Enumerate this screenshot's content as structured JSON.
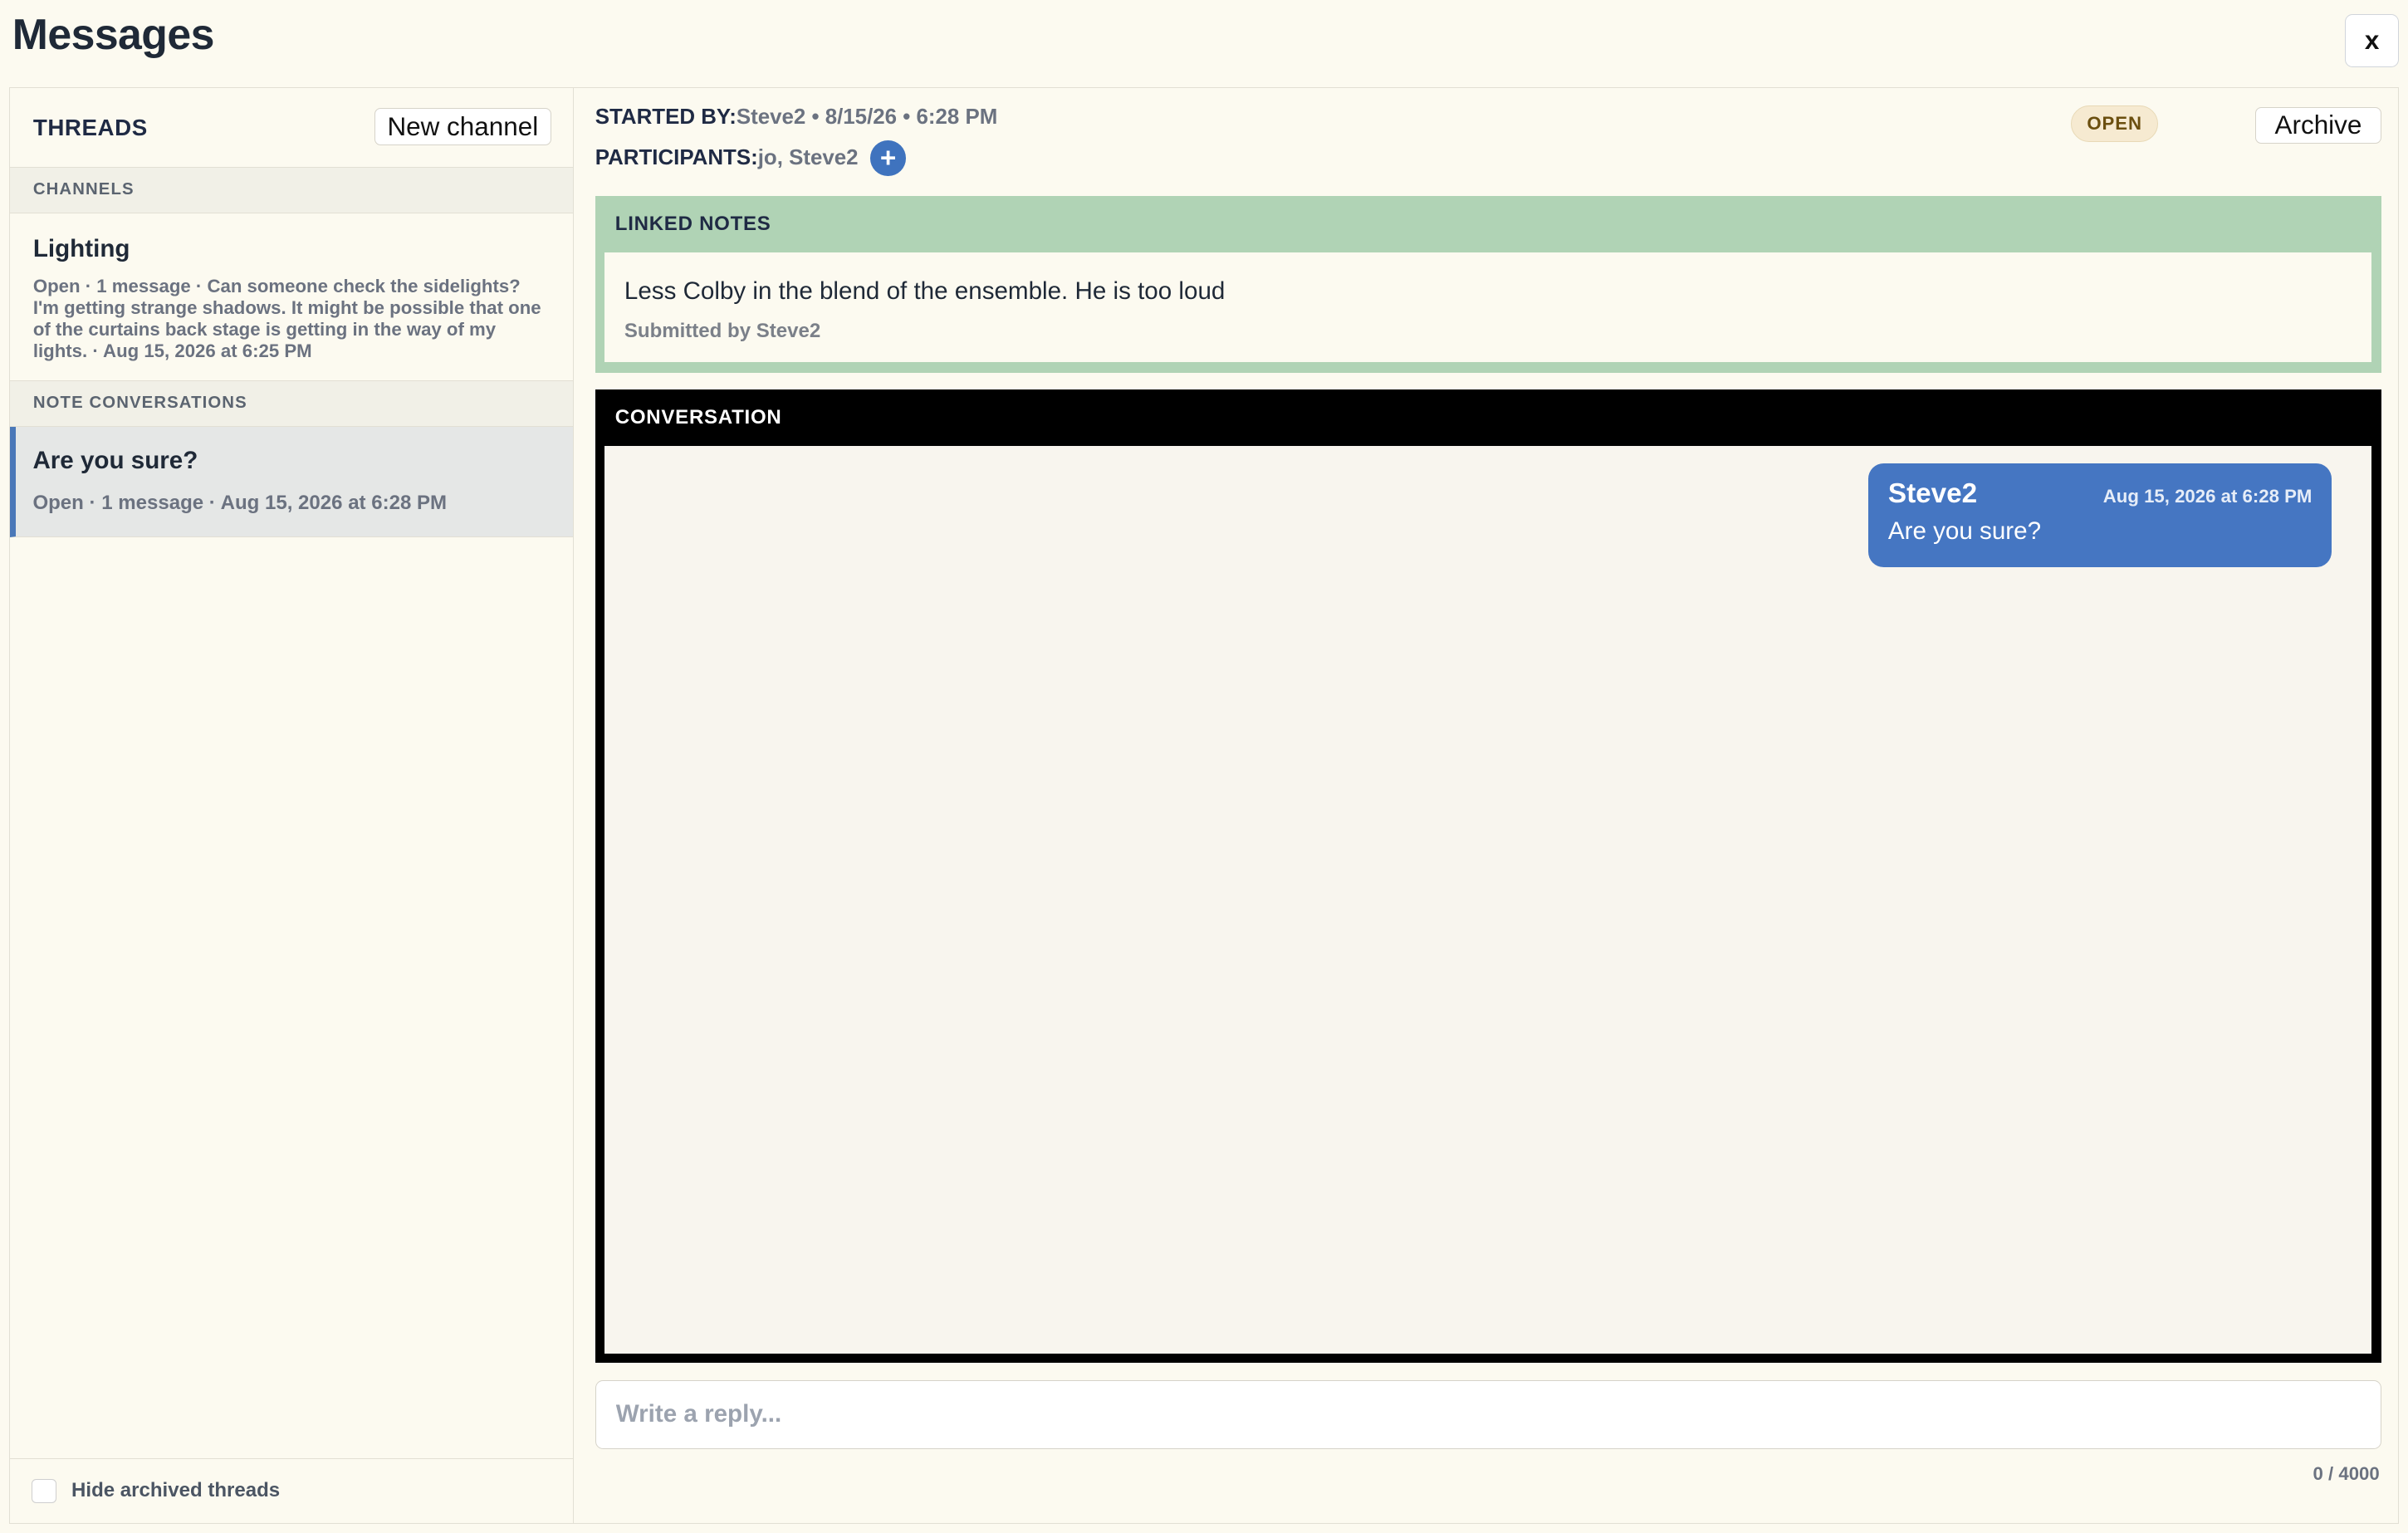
{
  "window": {
    "title": "Messages",
    "close_label": "x"
  },
  "sidebar": {
    "threads_label": "THREADS",
    "new_channel_label": "New channel",
    "channels_header": "CHANNELS",
    "channels": [
      {
        "title": "Lighting",
        "meta": "Open · 1 message · Can someone check the sidelights? I'm getting strange shadows. It might be possible that one of the curtains back stage is getting in the way of my lights. · Aug 15, 2026 at 6:25 PM"
      }
    ],
    "notes_header": "NOTE CONVERSATIONS",
    "notes": [
      {
        "title": "Are you sure?",
        "meta": "Open · 1 message · Aug 15, 2026 at 6:28 PM"
      }
    ],
    "hide_archived_label": "Hide archived threads"
  },
  "thread": {
    "started_by_label": "STARTED BY:",
    "started_by_value": "Steve2 • 8/15/26 • 6:28 PM",
    "participants_label": "PARTICIPANTS:",
    "participants_value": "jo, Steve2",
    "add_participant_symbol": "+",
    "status": "OPEN",
    "archive_label": "Archive"
  },
  "linked_notes": {
    "header": "LINKED NOTES",
    "note_text": "Less Colby in the blend of the ensemble. He is too loud",
    "submitted_by": "Submitted by Steve2"
  },
  "conversation": {
    "header": "CONVERSATION",
    "messages": [
      {
        "author": "Steve2",
        "time": "Aug 15, 2026 at 6:28 PM",
        "text": "Are you sure?"
      }
    ]
  },
  "reply": {
    "placeholder": "Write a reply...",
    "value": "",
    "counter": "0 / 4000"
  },
  "colors": {
    "accent_blue": "#4576c2",
    "linked_green": "#b0d3b5",
    "background": "#fcfaf0",
    "open_pill": "#f6ead1"
  }
}
